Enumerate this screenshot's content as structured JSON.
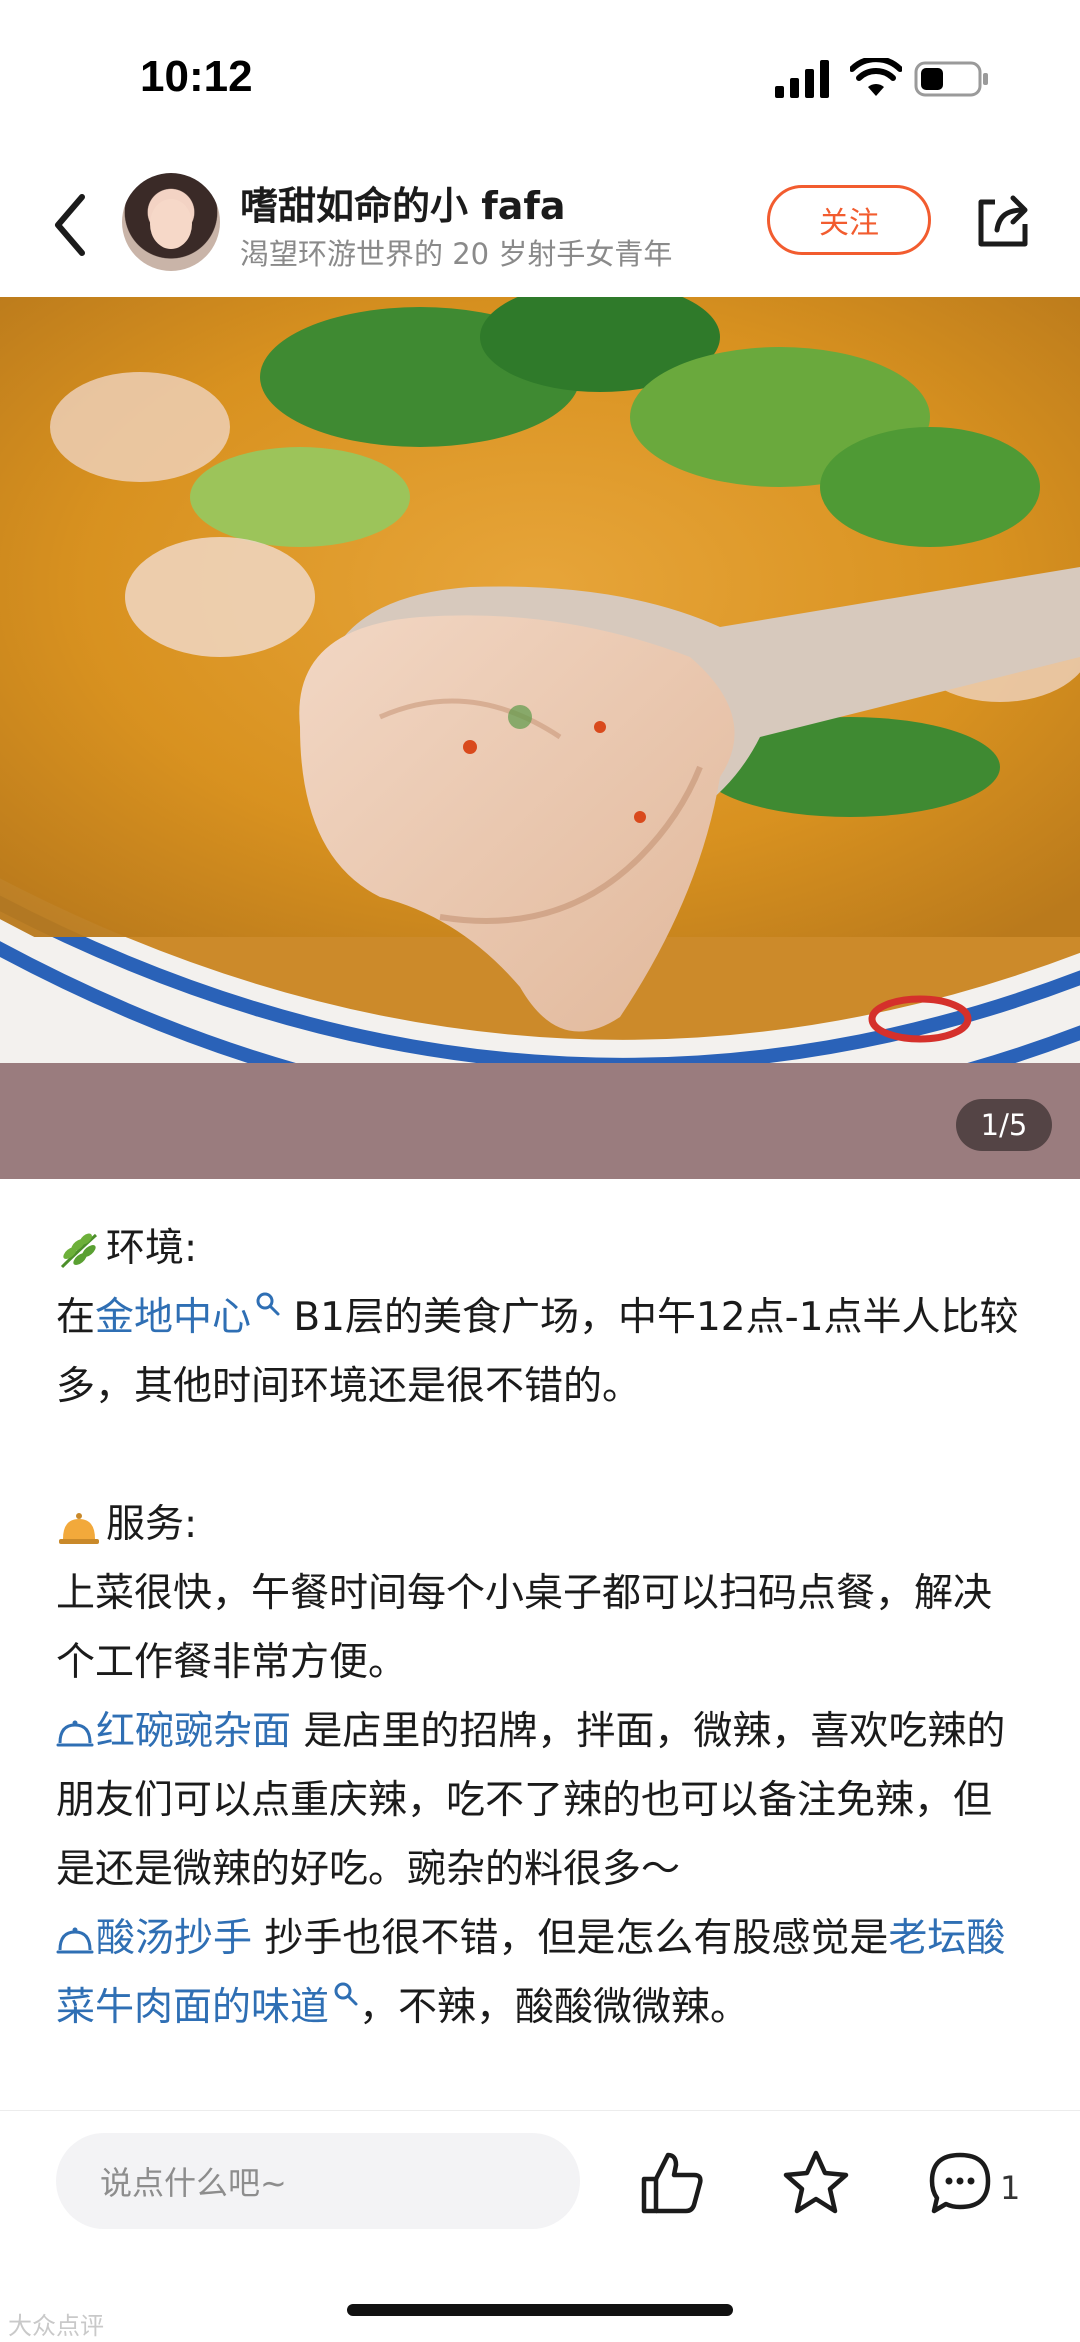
{
  "status_bar": {
    "time": "10:12",
    "signal_icon": "signal-icon",
    "wifi_icon": "wifi-icon",
    "battery_icon": "battery-icon"
  },
  "header": {
    "user_name": "嗜甜如命的小 fafa",
    "user_bio": "渴望环游世界的 20 岁射手女青年",
    "follow_label": "关注"
  },
  "gallery": {
    "counter": "1/5"
  },
  "post": {
    "env_heading": "环境:",
    "env_pre": "在",
    "env_link": "金地中心",
    "env_text": " B1层的美食广场，中午12点-1点半人比较多，其他时间环境还是很不错的。",
    "service_heading": "服务:",
    "service_text": "上菜很快，午餐时间每个小桌子都可以扫码点餐，解决个工作餐非常方便。",
    "dish1_link": "红碗豌杂面",
    "dish1_text": " 是店里的招牌，拌面，微辣，喜欢吃辣的朋友们可以点重庆辣，吃不了辣的也可以备注免辣，但是还是微辣的好吃。豌杂的料很多～",
    "dish2_link": "酸汤抄手",
    "dish2_text": " 抄手也很不错，但是怎么有股感觉是",
    "dish2_link2": "老坛酸菜牛肉面的味道",
    "dish2_tail": "，不辣，酸酸微微辣。"
  },
  "bottom_bar": {
    "comment_placeholder": "说点什么吧~",
    "comment_count": "1"
  },
  "watermark": "大众点评",
  "colors": {
    "accent": "#f25c2f",
    "link": "#2f6fb4"
  }
}
